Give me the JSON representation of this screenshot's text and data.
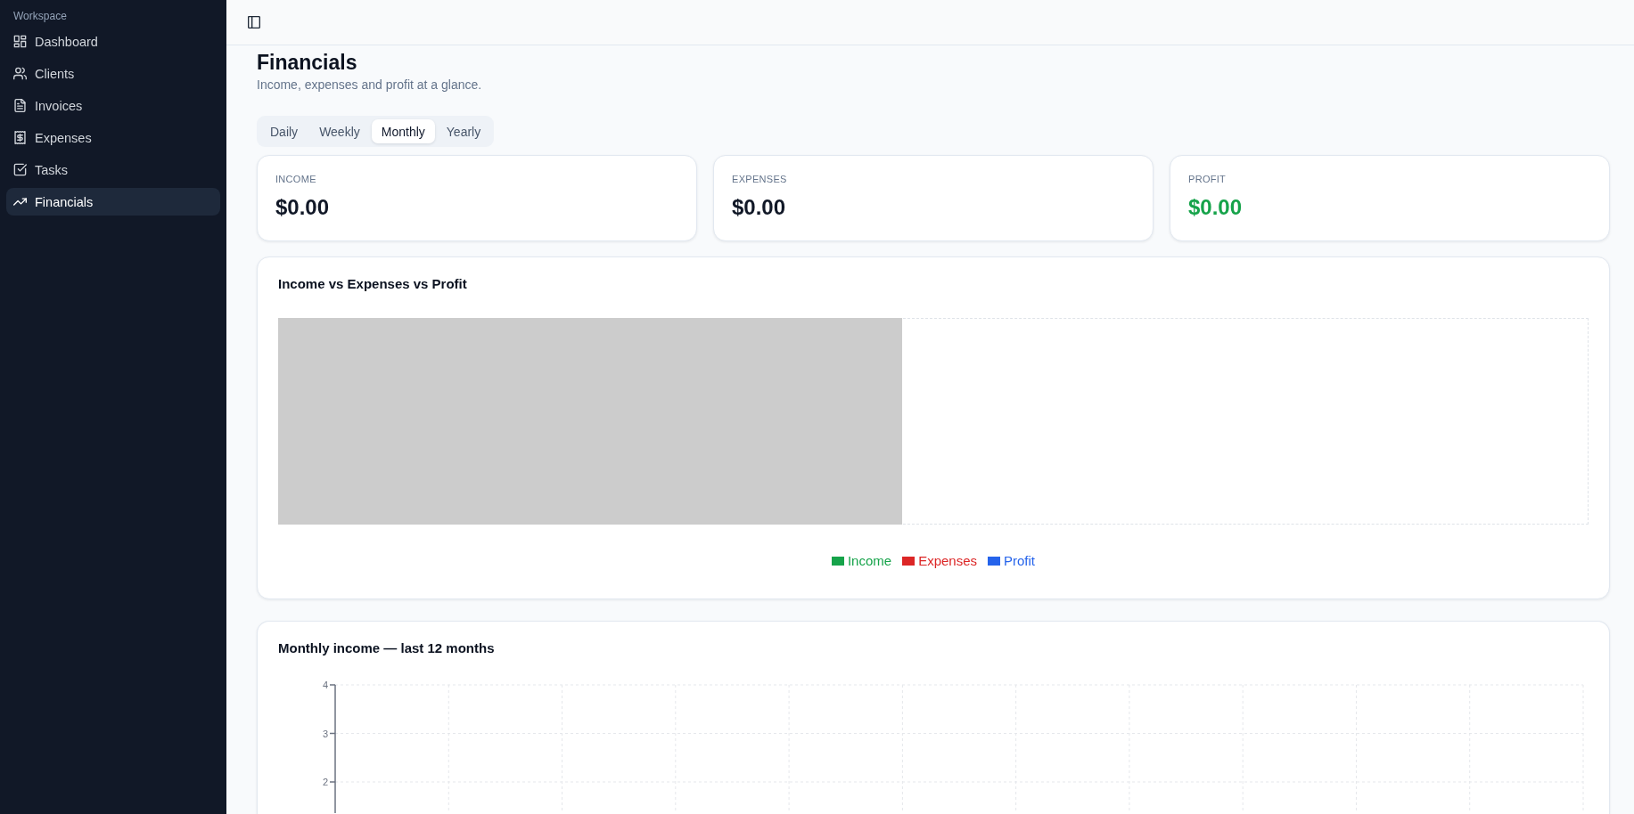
{
  "sidebar": {
    "section": "Workspace",
    "items": [
      {
        "label": "Dashboard",
        "selected": false
      },
      {
        "label": "Clients",
        "selected": false
      },
      {
        "label": "Invoices",
        "selected": false
      },
      {
        "label": "Expenses",
        "selected": false
      },
      {
        "label": "Tasks",
        "selected": false
      },
      {
        "label": "Financials",
        "selected": true
      }
    ]
  },
  "page": {
    "title": "Financials",
    "subtitle": "Income, expenses and profit at a glance."
  },
  "tabs": [
    {
      "label": "Daily",
      "selected": false
    },
    {
      "label": "Weekly",
      "selected": false
    },
    {
      "label": "Monthly",
      "selected": true
    },
    {
      "label": "Yearly",
      "selected": false
    }
  ],
  "stats": [
    {
      "label": "INCOME",
      "value": "$0.00",
      "color": "#111827"
    },
    {
      "label": "EXPENSES",
      "value": "$0.00",
      "color": "#111827"
    },
    {
      "label": "PROFIT",
      "value": "$0.00",
      "color": "#16a34a"
    }
  ],
  "summary_chart": {
    "title": "Income vs Expenses vs Profit",
    "legend": [
      {
        "label": "Income",
        "color": "#16a34a"
      },
      {
        "label": "Expenses",
        "color": "#dc2626"
      },
      {
        "label": "Profit",
        "color": "#2563eb"
      }
    ]
  },
  "income_chart": {
    "title": "Monthly income — last 12 months",
    "y_axis_labels": [
      "4",
      "3",
      "2"
    ]
  }
}
